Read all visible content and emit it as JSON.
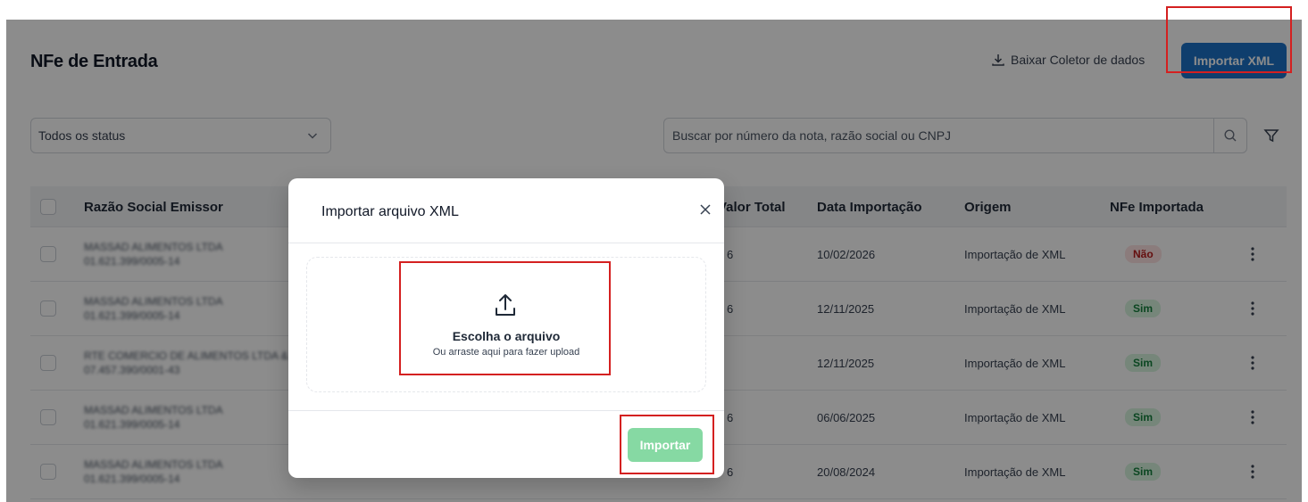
{
  "header": {
    "title": "NFe de Entrada",
    "download_label": "Baixar Coletor de dados",
    "import_xml_label": "Importar XML"
  },
  "filters": {
    "status_value": "Todos os status",
    "search_placeholder": "Buscar por número da nota, razão social ou CNPJ"
  },
  "table": {
    "columns": [
      "Razão Social Emissor",
      "Valor Total",
      "Data Importação",
      "Origem",
      "NFe Importada"
    ],
    "rows": [
      {
        "name": "MASSAD ALIMENTOS LTDA",
        "doc": "01.621.399/0005-14",
        "value_tail": "6",
        "date": "10/02/2026",
        "origin": "Importação de XML",
        "imported": "Não"
      },
      {
        "name": "MASSAD ALIMENTOS LTDA",
        "doc": "01.621.399/0005-14",
        "value_tail": "6",
        "date": "12/11/2025",
        "origin": "Importação de XML",
        "imported": "Sim"
      },
      {
        "name": "RTE COMERCIO DE ALIMENTOS LTDA &",
        "doc": "07.457.390/0001-43",
        "value_tail": "",
        "date": "12/11/2025",
        "origin": "Importação de XML",
        "imported": "Sim"
      },
      {
        "name": "MASSAD ALIMENTOS LTDA",
        "doc": "01.621.399/0005-14",
        "value_tail": "6",
        "date": "06/06/2025",
        "origin": "Importação de XML",
        "imported": "Sim"
      },
      {
        "name": "MASSAD ALIMENTOS LTDA",
        "doc": "01.621.399/0005-14",
        "value_tail": "6",
        "date": "20/08/2024",
        "origin": "Importação de XML",
        "imported": "Sim"
      }
    ]
  },
  "modal": {
    "title": "Importar arquivo XML",
    "dropzone_title": "Escolha o arquivo",
    "dropzone_subtitle": "Ou arraste aqui para fazer upload",
    "import_button": "Importar"
  },
  "colors": {
    "primary": "#1d72c7",
    "import_disabled": "#86d9a3",
    "highlight": "#d42020",
    "badge_no_bg": "#fde2e2",
    "badge_yes_bg": "#d7f4df"
  }
}
